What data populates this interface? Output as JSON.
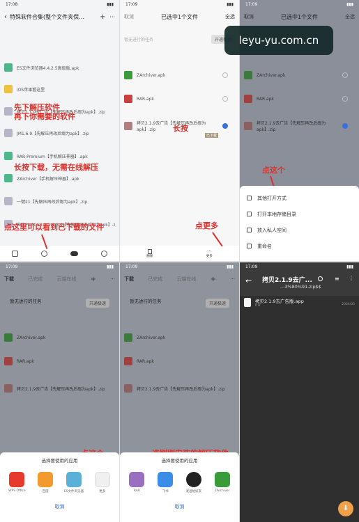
{
  "watermark": "leyu-yu.com.cn",
  "panel1": {
    "time": "17:08",
    "title": "特殊软件合集(整个文件夹保…",
    "files": [
      "ES文件浏览器4.4.2.5高级版.apk",
      "iOS苹果看这里",
      "拷贝2.1.9去广告【先解压再改后缀为apk】.zip",
      "JM1.6.9【先解压再改后缀为apk】.zip",
      "RAR-Premium【手机解压神器】.apk",
      "ZArchiver【手机解压神器】.apk",
      "一键21【先解压再改后缀为apk】.zip",
      "哔咔PicACG2.2.1.3.3.4【先解压再改后缀为apk】.zip"
    ],
    "notes": {
      "n1a": "先下解压软件",
      "n1b": "再下你需要的软件",
      "n2": "长按下载，无需在线解压",
      "n3": "点这里可以看到已下载的文件"
    }
  },
  "panel2": {
    "time": "17:09",
    "cancel": "取消",
    "title": "已选中1个文件",
    "select_all": "全选",
    "banner": "暂无进行的任务",
    "banner_btn": "开通极速",
    "files": [
      "ZArchiver.apk",
      "RAR.apk",
      "拷贝2.1.9去广告【先解压再改后缀为apk】.zip"
    ],
    "tag": "长按",
    "tag_small": "已下载",
    "bottom": [
      "删除",
      "更多"
    ],
    "note": "点更多"
  },
  "panel3": {
    "time": "17:09",
    "cancel": "取消",
    "title": "已选中1个文件",
    "select_all": "全选",
    "banner_btn": "开通极速",
    "files": [
      "ZArchiver.apk",
      "RAR.apk",
      "拷贝2.1.9去广告【先解压再改后缀为apk】.zip"
    ],
    "note": "点这个",
    "menu": [
      "其他打开方式",
      "打开本地存储目录",
      "放入私人空间",
      "重命名"
    ]
  },
  "panel4": {
    "time": "17:09",
    "tabs": [
      "下载",
      "已完成",
      "云端在线"
    ],
    "banner": "暂无进行的任务",
    "banner_btn": "开通极速",
    "files": [
      "ZArchiver.apk",
      "RAR.apk",
      "拷贝2.1.9去广告【先解压再改后缀为apk】.zip"
    ],
    "note": "点这个",
    "sheet_title": "选择要使用的应用",
    "apps": [
      "WPS Office",
      "百度",
      "ES文件浏览器",
      "更多"
    ],
    "cancel": "取消"
  },
  "panel5": {
    "time": "17:09",
    "tabs": [
      "下载",
      "已完成",
      "云端在线"
    ],
    "banner": "暂无进行的任务",
    "banner_btn": "开通极速",
    "files": [
      "ZArchiver.apk",
      "RAR.apk",
      "拷贝2.1.9去广告【先解压再改后缀为apk】.zip"
    ],
    "note": "选刚刚安装的解压软件",
    "sheet_title": "选择要使用的应用",
    "apps": [
      "RAR",
      "飞书",
      "发送给好友",
      "ZArchiver"
    ],
    "cancel": "取消"
  },
  "panel6": {
    "time": "17:09",
    "title": "拷贝2.1.9去广...",
    "subtitle": "...3%80%91.zip$$",
    "file": "拷贝2.1.9去广告版.app",
    "size": "0 B",
    "date": "2024/05"
  },
  "colors": {
    "accent_red": "#e0302c",
    "zarchiver_green": "#3a9b3a",
    "wps_red": "#e63a2c",
    "select_blue": "#3a6fe0"
  }
}
